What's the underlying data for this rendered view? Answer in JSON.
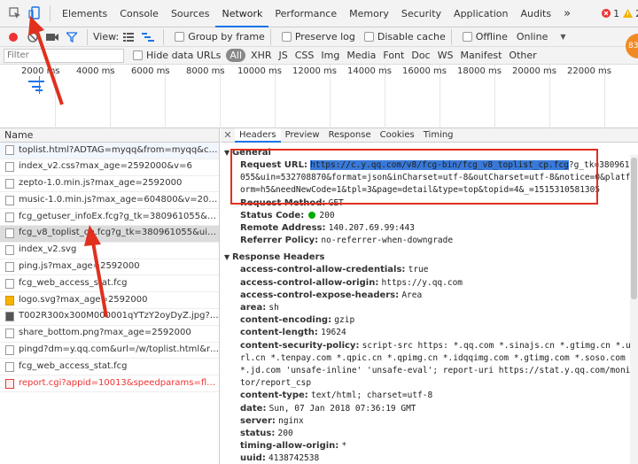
{
  "tabs": [
    "Elements",
    "Console",
    "Sources",
    "Network",
    "Performance",
    "Memory",
    "Security",
    "Application",
    "Audits"
  ],
  "more_tabs": "»",
  "errors": "1",
  "warnings": "2",
  "menu": "⋮",
  "close": "✕",
  "toolbar": {
    "view_label": "View:",
    "group_by_frame": "Group by frame",
    "preserve_log": "Preserve log",
    "disable_cache": "Disable cache",
    "offline": "Offline",
    "throttle": "Online"
  },
  "filter": {
    "placeholder": "Filter",
    "hide_data_urls": "Hide data URLs",
    "types": [
      "All",
      "XHR",
      "JS",
      "CSS",
      "Img",
      "Media",
      "Font",
      "Doc",
      "WS",
      "Manifest",
      "Other"
    ]
  },
  "badge": "83",
  "timeline_ticks": [
    "2000 ms",
    "4000 ms",
    "6000 ms",
    "8000 ms",
    "10000 ms",
    "12000 ms",
    "14000 ms",
    "16000 ms",
    "18000 ms",
    "20000 ms",
    "22000 ms"
  ],
  "list_header": "Name",
  "requests": [
    "toplist.html?ADTAG=myqq&from=myqq&chann...",
    "index_v2.css?max_age=2592000&v=6",
    "zepto-1.0.min.js?max_age=2592000",
    "music-1.0.min.js?max_age=604800&v=2017110...",
    "fcg_getuser_infoEx.fcg?g_tk=380961055&uin=5...",
    "fcg_v8_toplist_cp.fcg?g_tk=380961055&uin=532...",
    "index_v2.svg",
    "ping.js?max_age=2592000",
    "fcg_web_access_stat.fcg",
    "logo.svg?max_age=2592000",
    "T002R300x300M000001qYTzY2oyDyZ.jpg?max_...",
    "share_bottom.png?max_age=2592000",
    "pingd?dm=y.qq.com&url=/w/toplist.html&rdm...",
    "fcg_web_access_stat.fcg",
    "report.cgi?appid=10013&speedparams=flag1%..."
  ],
  "detail_tabs": [
    "Headers",
    "Preview",
    "Response",
    "Cookies",
    "Timing"
  ],
  "general": {
    "title": "General",
    "request_url_label": "Request URL:",
    "request_url_hl": "https://c.y.qq.com/v8/fcg-bin/fcg_v8_toplist_cp.fcg",
    "request_url_rest": "?g_tk=380961055&uin=532708870&format=json&inCharset=utf-8&outCharset=utf-8&notice=0&platform=h5&needNewCode=1&tpl=3&page=detail&type=top&topid=4&_=1515310581305",
    "method_label": "Request Method:",
    "method": "GET",
    "status_label": "Status Code:",
    "status": "200",
    "remote_label": "Remote Address:",
    "remote": "140.207.69.99:443",
    "referrer_label": "Referrer Policy:",
    "referrer": "no-referrer-when-downgrade"
  },
  "response_headers": {
    "title": "Response Headers",
    "items": [
      {
        "k": "access-control-allow-credentials:",
        "v": "true"
      },
      {
        "k": "access-control-allow-origin:",
        "v": "https://y.qq.com"
      },
      {
        "k": "access-control-expose-headers:",
        "v": "Area"
      },
      {
        "k": "area:",
        "v": "sh"
      },
      {
        "k": "content-encoding:",
        "v": "gzip"
      },
      {
        "k": "content-length:",
        "v": "19624"
      },
      {
        "k": "content-security-policy:",
        "v": "script-src https: *.qq.com *.sinajs.cn *.gtimg.cn *.url.cn *.tenpay.com *.qpic.cn *.qpimg.cn *.idqqimg.com *.gtimg.com *.soso.com *.jd.com 'unsafe-inline' 'unsafe-eval'; report-uri https://stat.y.qq.com/monitor/report_csp"
      },
      {
        "k": "content-type:",
        "v": "text/html; charset=utf-8"
      },
      {
        "k": "date:",
        "v": "Sun, 07 Jan 2018 07:36:19 GMT"
      },
      {
        "k": "server:",
        "v": "nginx"
      },
      {
        "k": "status:",
        "v": "200"
      },
      {
        "k": "timing-allow-origin:",
        "v": "*"
      },
      {
        "k": "uuid:",
        "v": "4138742538"
      }
    ]
  }
}
